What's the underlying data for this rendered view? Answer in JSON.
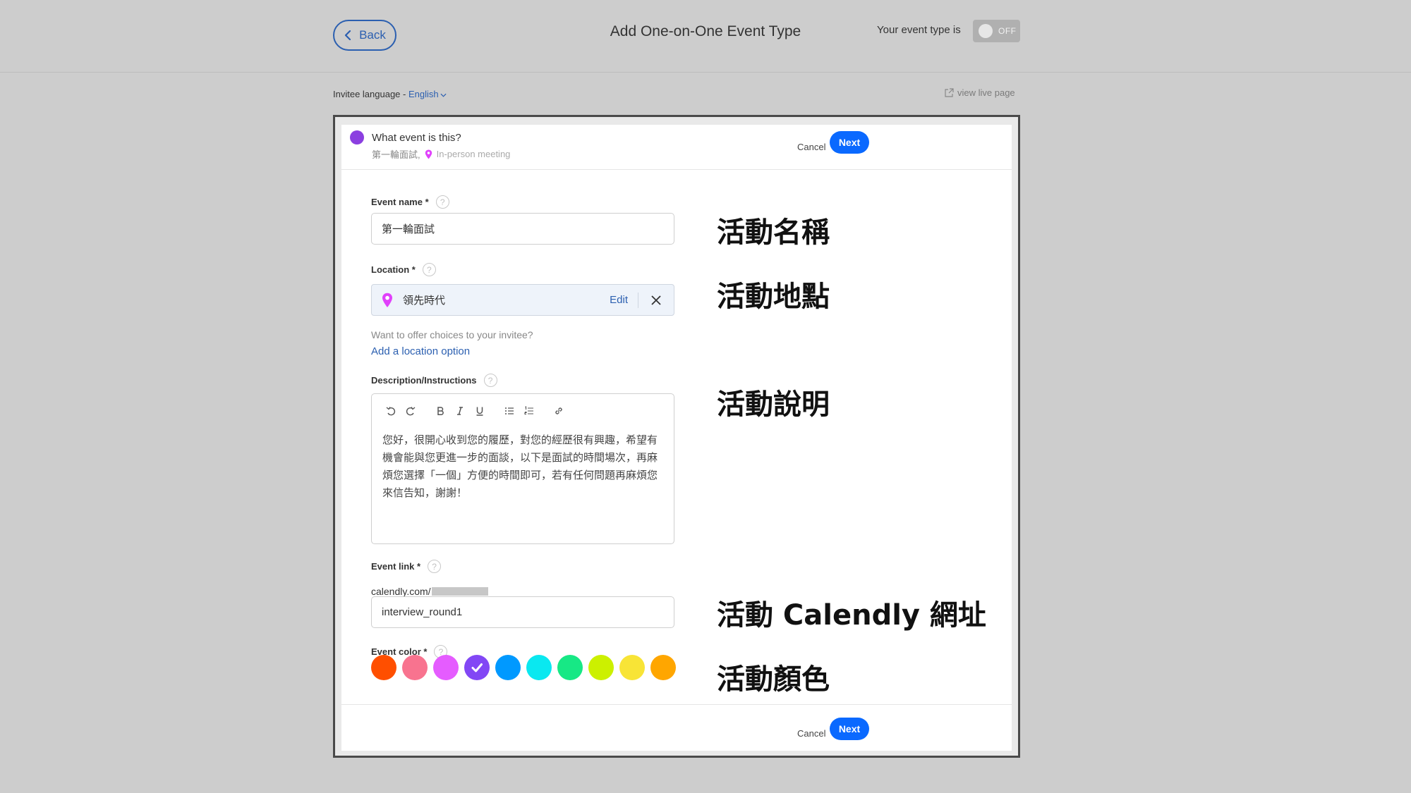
{
  "topbar": {
    "back_label": "Back",
    "title": "Add One-on-One Event Type",
    "toggle_label": "Your event type is",
    "toggle_state": "OFF"
  },
  "lang_row": {
    "label": "Invitee language - ",
    "language": "English",
    "view_live": "view live page"
  },
  "card": {
    "header": {
      "question": "What event is this?",
      "event_name": "第一輪面試,",
      "meeting_type": "In-person meeting",
      "cancel": "Cancel",
      "next": "Next"
    },
    "event_name": {
      "label": "Event name *",
      "value": "第一輪面試"
    },
    "location": {
      "label": "Location *",
      "value": "領先時代",
      "edit": "Edit",
      "hint": "Want to offer choices to your invitee?",
      "add_option": "Add a location option"
    },
    "description": {
      "label": "Description/Instructions",
      "text": "您好，很開心收到您的履歷，對您的經歷很有興趣，希望有機會能與您更進一步的面談，以下是面試的時間場次，再麻煩您選擇「一個」方便的時間即可，若有任何問題再麻煩您來信告知，謝謝！"
    },
    "event_link": {
      "label": "Event link *",
      "prefix": "calendly.com/",
      "value": "interview_round1"
    },
    "event_color": {
      "label": "Event color *",
      "colors": [
        "#ff4f00",
        "#f8738f",
        "#e55cff",
        "#8247f5",
        "#0099ff",
        "#0ae8f0",
        "#17e885",
        "#ccf000",
        "#f8e436",
        "#ffa600"
      ],
      "selected_index": 3
    },
    "footer": {
      "cancel": "Cancel",
      "next": "Next"
    }
  },
  "annotations": {
    "name": "活動名稱",
    "location": "活動地點",
    "description": "活動說明",
    "link": "活動 Calendly 網址",
    "color": "活動顏色"
  },
  "help_glyph": "?"
}
